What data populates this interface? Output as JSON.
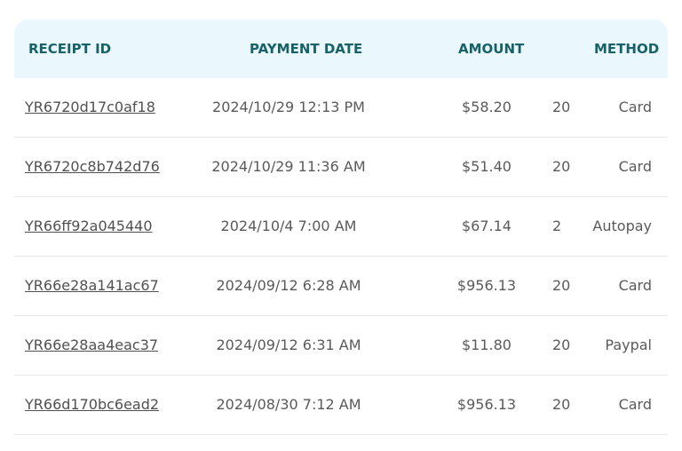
{
  "table": {
    "headers": {
      "receipt_id": "RECEIPT ID",
      "payment_date": "PAYMENT DATE",
      "amount": "AMOUNT",
      "method": "METHOD"
    },
    "rows": [
      {
        "receipt_id": "YR6720d17c0af18",
        "payment_date": "2024/10/29 12:13 PM",
        "amount": "$58.20",
        "extra": "20",
        "method": "Card"
      },
      {
        "receipt_id": "YR6720c8b742d76",
        "payment_date": "2024/10/29 11:36 AM",
        "amount": "$51.40",
        "extra": "20",
        "method": "Card"
      },
      {
        "receipt_id": "YR66ff92a045440",
        "payment_date": "2024/10/4 7:00 AM",
        "amount": "$67.14",
        "extra": "2",
        "method": "Autopay"
      },
      {
        "receipt_id": "YR66e28a141ac67",
        "payment_date": "2024/09/12 6:28 AM",
        "amount": "$956.13",
        "extra": "20",
        "method": "Card"
      },
      {
        "receipt_id": "YR66e28aa4eac37",
        "payment_date": "2024/09/12 6:31 AM",
        "amount": "$11.80",
        "extra": "20",
        "method": "Paypal"
      },
      {
        "receipt_id": "YR66d170bc6ead2",
        "payment_date": "2024/08/30 7:12 AM",
        "amount": "$956.13",
        "extra": "20",
        "method": "Card"
      }
    ]
  }
}
